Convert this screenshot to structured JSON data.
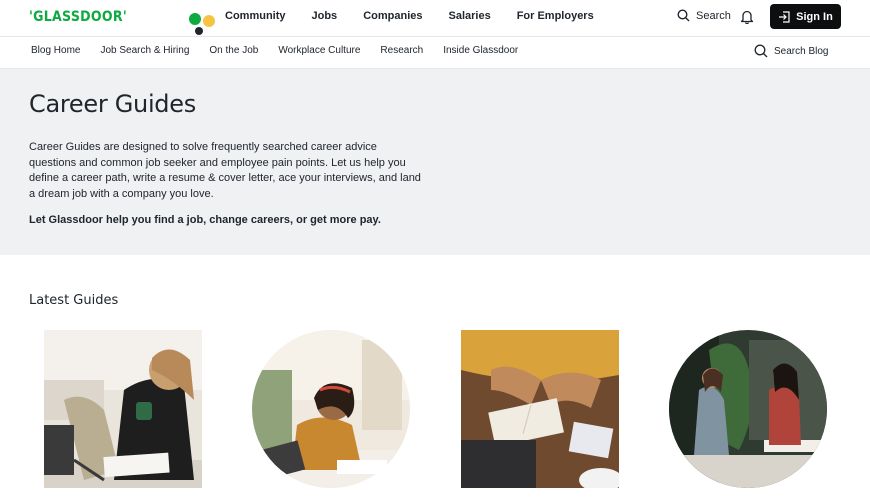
{
  "brand": {
    "logo_text": "'GLASSDOOR'",
    "accent": "#0caa41"
  },
  "topnav": {
    "items": [
      "Community",
      "Jobs",
      "Companies",
      "Salaries",
      "For Employers"
    ],
    "search_label": "Search",
    "signin_label": "Sign In"
  },
  "blognav": {
    "items": [
      "Blog Home",
      "Job Search & Hiring",
      "On the Job",
      "Workplace Culture",
      "Research",
      "Inside Glassdoor"
    ],
    "search_label": "Search Blog"
  },
  "hero": {
    "title": "Career Guides",
    "description": "Career Guides are designed to solve frequently searched career advice questions and common job seeker and employee pain points. Let us help you define a career path, write a resume & cover letter, ace your interviews, and land a dream job with a company you love.",
    "cta": "Let Glassdoor help you find a job, change careers, or get more pay."
  },
  "latest": {
    "heading": "Latest Guides"
  }
}
